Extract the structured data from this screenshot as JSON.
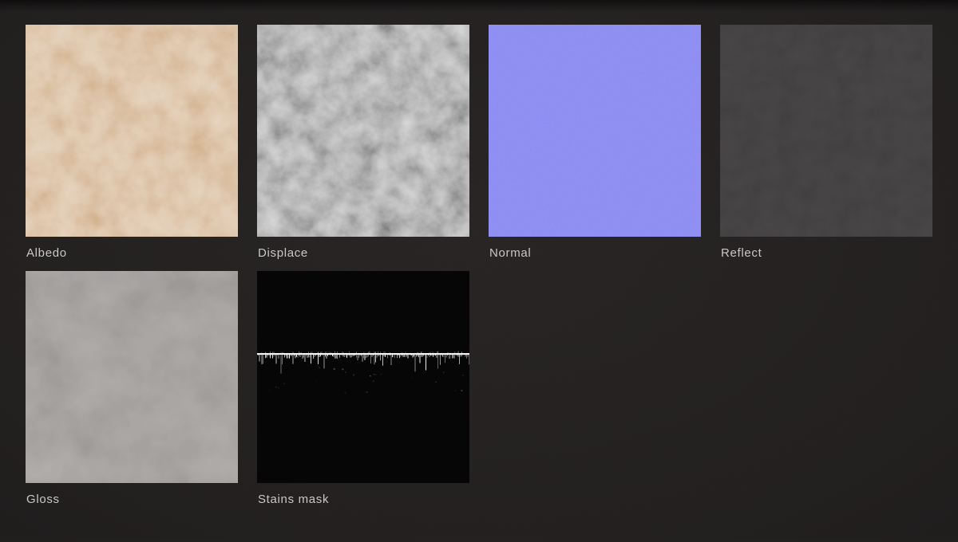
{
  "page": {
    "background_center": "#282424",
    "background_edge": "#161313",
    "label_color": "#cac7c4"
  },
  "tiles": [
    {
      "label": "Albedo",
      "color": "#d6b795"
    },
    {
      "label": "Displace",
      "color": "#9c9c9c"
    },
    {
      "label": "Normal",
      "color": "#8d8cf2"
    },
    {
      "label": "Reflect",
      "color": "#403e3e"
    },
    {
      "label": "Gloss",
      "color": "#9b9795"
    },
    {
      "label": "Stains mask",
      "color": "#060606"
    }
  ]
}
